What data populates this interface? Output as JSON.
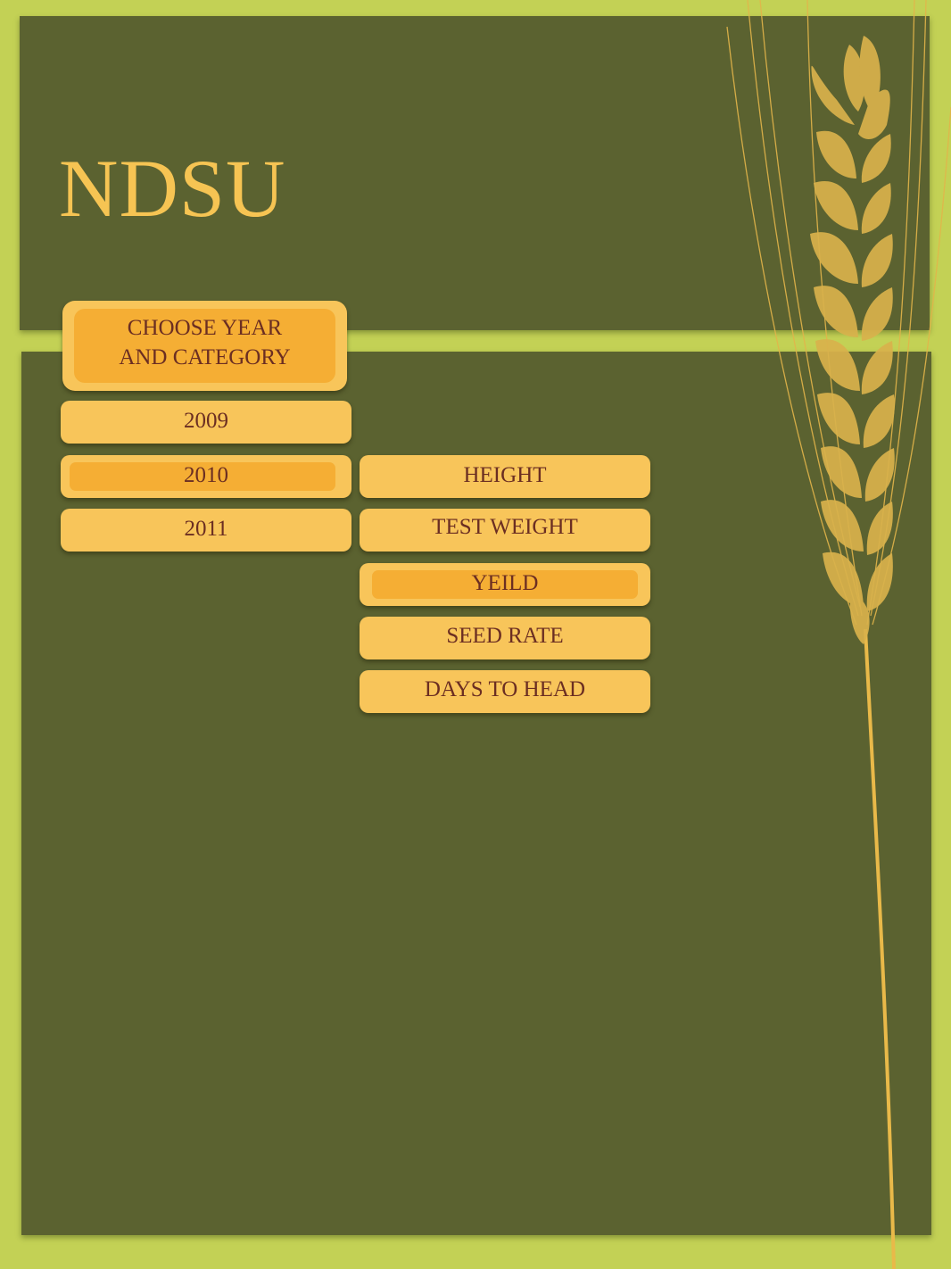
{
  "header": {
    "title": "NDSU"
  },
  "menu": {
    "prompt": "CHOOSE YEAR\nAND CATEGORY",
    "years": [
      {
        "label": "2009",
        "selected": false
      },
      {
        "label": "2010",
        "selected": true
      },
      {
        "label": "2011",
        "selected": false
      }
    ],
    "categories": [
      {
        "label": "HEIGHT",
        "selected": false
      },
      {
        "label": "TEST WEIGHT",
        "selected": false
      },
      {
        "label": "YEILD",
        "selected": true
      },
      {
        "label": "SEED RATE",
        "selected": false
      },
      {
        "label": "DAYS TO HEAD",
        "selected": false
      }
    ]
  },
  "colors": {
    "background": "#c3d155",
    "panel": "#5b6230",
    "title": "#f6c453",
    "button": "#f8c55a",
    "button_selected": "#f5ae34",
    "button_text": "#6b2e22",
    "wheat": "#e3b54a"
  },
  "decor": {
    "icon": "wheat-stalk-icon"
  }
}
